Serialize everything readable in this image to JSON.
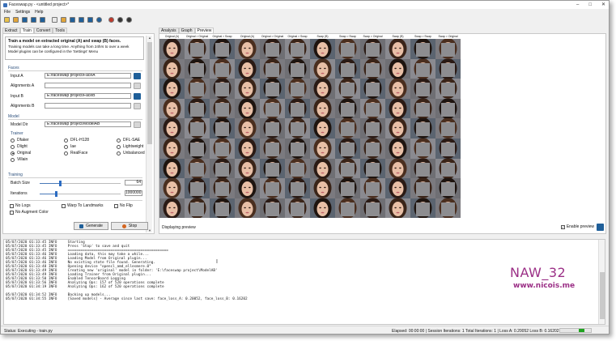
{
  "window": {
    "title": "Faceswap.py - <untitled project>*",
    "menu": [
      "File",
      "Settings",
      "Help"
    ]
  },
  "toolbar": {
    "icons": [
      {
        "name": "new-project-icon",
        "color": "#e8c14a"
      },
      {
        "name": "open-project-icon",
        "color": "#e0a43a"
      },
      {
        "name": "save-project-icon",
        "color": "#1f5f99"
      },
      {
        "name": "save-as-icon",
        "color": "#1f5f99"
      },
      {
        "name": "reload-icon",
        "color": "#1f5f99"
      },
      {
        "name": "new-task-icon",
        "color": "#e8e8e8"
      },
      {
        "name": "open-task-icon",
        "color": "#e0a43a"
      },
      {
        "name": "save-task-icon",
        "color": "#1f5f99"
      },
      {
        "name": "save-task-as-icon",
        "color": "#1f5f99"
      },
      {
        "name": "clear-icon",
        "color": "#1f5f99"
      },
      {
        "name": "settings-icon",
        "color": "#1f5f99"
      },
      {
        "name": "stop-icon",
        "color": "#c0392b"
      },
      {
        "name": "help-icon",
        "color": "#333333"
      },
      {
        "name": "info-icon",
        "color": "#333333"
      }
    ]
  },
  "left_tabs": [
    "Extract",
    "Train",
    "Convert",
    "Tools"
  ],
  "info": {
    "heading": "Train a model on extracted original (A) and swap (B) faces.",
    "line1": "Training models can take a long time. Anything from 24hrs to over a week",
    "line2": "Model plugins can be configured in the 'Settings' Menu"
  },
  "faces": {
    "section": "Faces",
    "input_a_label": "Input A",
    "input_a_value": "E:/faceswap project/FaceA",
    "alignments_a_label": "Alignments A",
    "alignments_a_value": "",
    "input_b_label": "Input B",
    "input_b_value": "E:/faceswap project/FaceB",
    "alignments_b_label": "Alignments B",
    "alignments_b_value": ""
  },
  "model": {
    "section": "Model",
    "dir_label": "Model Dir",
    "dir_value": "E:/faceswap project/ModelAB"
  },
  "trainer": {
    "section": "Trainer",
    "options": [
      "Dfaker",
      "DFL-H128",
      "DFL-SAE",
      "Dlight",
      "Iae",
      "Lightweight",
      "Original",
      "RealFace",
      "Unbalanced",
      "Villain"
    ],
    "selected": "Original"
  },
  "training": {
    "section": "Training",
    "batch_label": "Batch Size",
    "batch_value": "64",
    "batch_fraction": 0.25,
    "iter_label": "Iterations",
    "iter_value": "1000000",
    "iter_fraction": 0.2,
    "checks": {
      "no_logs": "No Logs",
      "warp": "Warp To Landmarks",
      "no_flip": "No Flip",
      "no_augment": "No Augment Color"
    }
  },
  "buttons": {
    "generate": "Generate",
    "stop": "Stop"
  },
  "right_tabs": [
    "Analysis",
    "Graph",
    "Preview"
  ],
  "preview": {
    "headers": [
      "Original (A)",
      "Original > Original",
      "Original > Swap",
      "Original (A)",
      "Original > Original",
      "Original > Swap",
      "Swap (B)",
      "Swap > Swap",
      "Swap > Original",
      "Swap (B)",
      "Swap > Swap",
      "Swap > Original"
    ],
    "rows": 9,
    "status": "Displaying preview",
    "enable_label": "Enable preview",
    "enabled": true
  },
  "console": {
    "lines": [
      "05/07/2020 01:33:45 INFO     Starting",
      "05/07/2020 01:33:45 INFO     Press 'Stop' to save and quit",
      "05/07/2020 01:33:45 INFO     ===============================================",
      "05/07/2020 01:33:46 INFO     Loading data, this may take a while...",
      "05/07/2020 01:33:46 INFO     Loading Model from Original plugin...",
      "05/07/2020 01:33:46 INFO     No existing state file found. Generating.",
      "05/07/2020 01:33:48 INFO     Opening device \"opencl_amd_ellesmere.0\"",
      "05/07/2020 01:33:49 INFO     Creating new 'original' model in folder: 'E:\\faceswap project\\ModelAB'",
      "05/07/2020 01:33:49 INFO     Loading Trainer from Original plugin...",
      "05/07/2020 01:33:50 INFO     Enabled TensorBoard Logging",
      "05/07/2020 01:33:56 INFO     Analyzing Ops: 157 of 520 operations complete",
      "05/07/2020 01:34:19 INFO     Analyzing Ops: 162 of 520 operations complete",
      "",
      "05/07/2020 01:34:52 INFO     Backing up models...",
      "05/07/2020 01:34:55 INFO     [Saved models] - Average since last save: face_loss_A: 0.20052, face_loss_B: 0.16202"
    ]
  },
  "watermark": {
    "name": "NAW_32",
    "url": "www.nicois.me",
    "color": "#9b2f86"
  },
  "statusbar": {
    "status": "Status: Executing - train.py",
    "stats": "Elapsed: 00:00:00 | Session Iterations: 1   Total Iterations: 1 | Loss A: 0.20052   Loss B: 0.16202"
  }
}
